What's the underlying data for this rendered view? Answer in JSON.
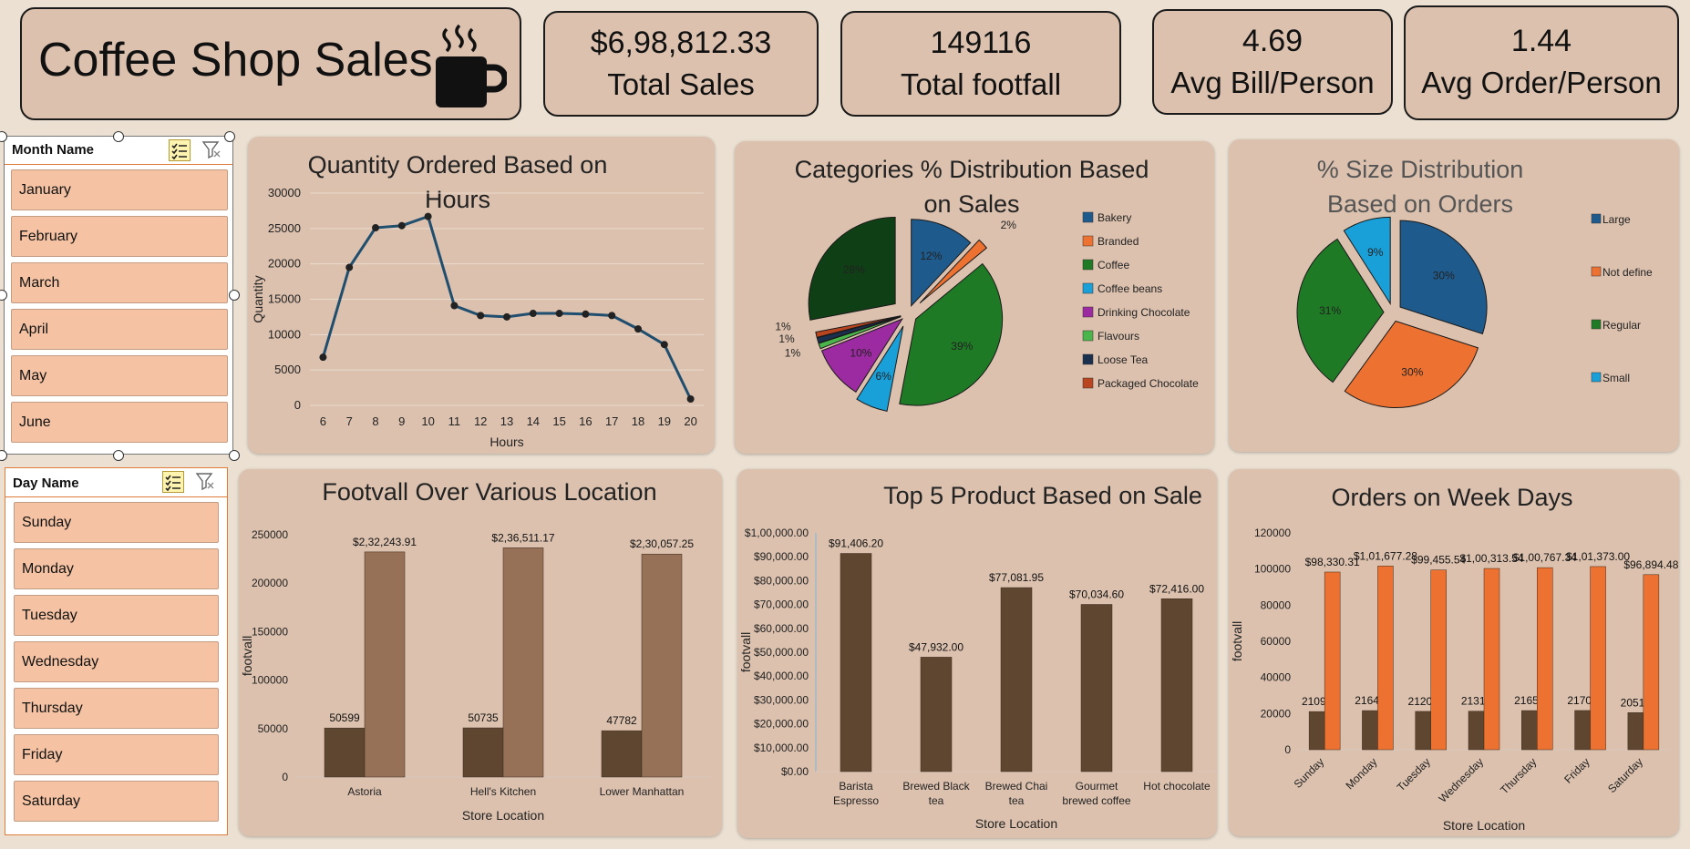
{
  "header": {
    "title": "Coffee Shop Sales",
    "icon": "coffee-cup-icon"
  },
  "kpis": [
    {
      "value": "$6,98,812.33",
      "label": "Total Sales"
    },
    {
      "value": "149116",
      "label": "Total footfall"
    },
    {
      "value": "4.69",
      "label": "Avg Bill/Person"
    },
    {
      "value": "1.44",
      "label": "Avg Order/Person"
    }
  ],
  "slicers": {
    "month": {
      "header": "Month Name",
      "items": [
        "January",
        "February",
        "March",
        "April",
        "May",
        "June"
      ]
    },
    "day": {
      "header": "Day Name",
      "items": [
        "Sunday",
        "Monday",
        "Tuesday",
        "Wednesday",
        "Thursday",
        "Friday",
        "Saturday"
      ]
    }
  },
  "colors": {
    "background": "#ebe0d2",
    "panel": "#dcc1ae",
    "slicer_item": "#f5c3a3",
    "bar_dark": "#5e4631",
    "bar_light": "#977157",
    "bar_orange": "#ed7231",
    "line": "#1f4e6e"
  },
  "chart_data": [
    {
      "id": "hours",
      "type": "line",
      "title": "Quantity Ordered Based on Hours",
      "xlabel": "Hours",
      "ylabel": "Quantity",
      "x": [
        6,
        7,
        8,
        9,
        10,
        11,
        12,
        13,
        14,
        15,
        16,
        17,
        18,
        19,
        20
      ],
      "values": [
        6800,
        19500,
        25100,
        25400,
        26700,
        14100,
        12700,
        12500,
        13000,
        13000,
        12900,
        12700,
        10800,
        8600,
        900
      ],
      "ylim": [
        0,
        30000
      ],
      "yticks": [
        0,
        5000,
        10000,
        15000,
        20000,
        25000,
        30000
      ]
    },
    {
      "id": "categories",
      "type": "pie",
      "title": "Categories % Distribution Based on Sales",
      "labels": [
        "Bakery",
        "Branded",
        "Coffee",
        "Coffee beans",
        "Drinking Chocolate",
        "Flavours",
        "Loose Tea",
        "Packaged Chocolate"
      ],
      "values": [
        12,
        2,
        39,
        6,
        10,
        1,
        1,
        1
      ],
      "slice_labels": [
        "12%",
        "2%",
        "39%",
        "6%",
        "10%",
        "1%",
        "1%",
        "1%"
      ],
      "extra_label": "28%",
      "colors": [
        "#1f5a8c",
        "#ed7231",
        "#1e7a25",
        "#1aa0d8",
        "#9c2aa0",
        "#4ab54a",
        "#1b2f4f",
        "#b8451f",
        "#0f3f14"
      ],
      "legend": "right"
    },
    {
      "id": "sizes",
      "type": "pie",
      "title": "% Size Distribution Based on Orders",
      "labels": [
        "Large",
        "Not define",
        "Regular",
        "Small"
      ],
      "values": [
        30,
        30,
        31,
        9
      ],
      "slice_labels": [
        "30%",
        "30%",
        "31%",
        "9%"
      ],
      "colors": [
        "#1f5a8c",
        "#ed7231",
        "#1e7a25",
        "#1aa0d8"
      ],
      "legend": "right"
    },
    {
      "id": "locations",
      "type": "bar",
      "title": "Footvall Over Various Location",
      "xlabel": "Store Location",
      "ylabel": "footvall",
      "categories": [
        "Astoria",
        "Hell's Kitchen",
        "Lower Manhattan"
      ],
      "series": [
        {
          "values": [
            50599,
            50735,
            47782
          ],
          "labels": [
            "50599",
            "50735",
            "47782"
          ]
        },
        {
          "values": [
            232243.91,
            236511.17,
            230057.25
          ],
          "labels": [
            "$2,32,243.91",
            "$2,36,511.17",
            "$2,30,057.25"
          ]
        }
      ],
      "ylim": [
        0,
        250000
      ],
      "yticks": [
        0,
        50000,
        100000,
        150000,
        200000,
        250000
      ]
    },
    {
      "id": "products",
      "type": "bar",
      "title": "Top 5 Product Based on Sale",
      "xlabel": "Store Location",
      "ylabel": "footvall",
      "categories": [
        [
          "Barista",
          "Espresso"
        ],
        [
          "Brewed Black",
          "tea"
        ],
        [
          "Brewed Chai",
          "tea"
        ],
        [
          "Gourmet",
          "brewed coffee"
        ],
        [
          "Hot chocolate"
        ]
      ],
      "series": [
        {
          "values": [
            91406.2,
            47932.0,
            77081.95,
            70034.6,
            72416.0
          ],
          "labels": [
            "$91,406.20",
            "$47,932.00",
            "$77,081.95",
            "$70,034.60",
            "$72,416.00"
          ]
        }
      ],
      "ylim": [
        0,
        100000
      ],
      "ytick_labels": [
        "$0.00",
        "$10,000.00",
        "$20,000.00",
        "$30,000.00",
        "$40,000.00",
        "$50,000.00",
        "$60,000.00",
        "$70,000.00",
        "$80,000.00",
        "$90,000.00",
        "$1,00,000.00"
      ]
    },
    {
      "id": "weekdays",
      "type": "bar",
      "title": "Orders on Week Days",
      "xlabel": "Store Location",
      "ylabel": "footvall",
      "categories": [
        "Sunday",
        "Monday",
        "Tuesday",
        "Wednesday",
        "Thursday",
        "Friday",
        "Saturday"
      ],
      "series": [
        {
          "values": [
            21096,
            21643,
            21202,
            21310,
            21654,
            21701,
            20510
          ],
          "labels": [
            "21096",
            "21643",
            "21202",
            "21310",
            "21654",
            "21701",
            "20510"
          ]
        },
        {
          "values": [
            98330.31,
            101677.28,
            99455.54,
            100313.54,
            100767.34,
            101373.0,
            96894.48
          ],
          "labels": [
            "$98,330.31",
            "$1,01,677.28",
            "$99,455.54",
            "$1,00,313.54",
            "$1,00,767.34",
            "$1,01,373.00",
            "$96,894.48"
          ]
        }
      ],
      "ylim": [
        0,
        120000
      ],
      "yticks": [
        0,
        20000,
        40000,
        60000,
        80000,
        100000,
        120000
      ]
    }
  ]
}
